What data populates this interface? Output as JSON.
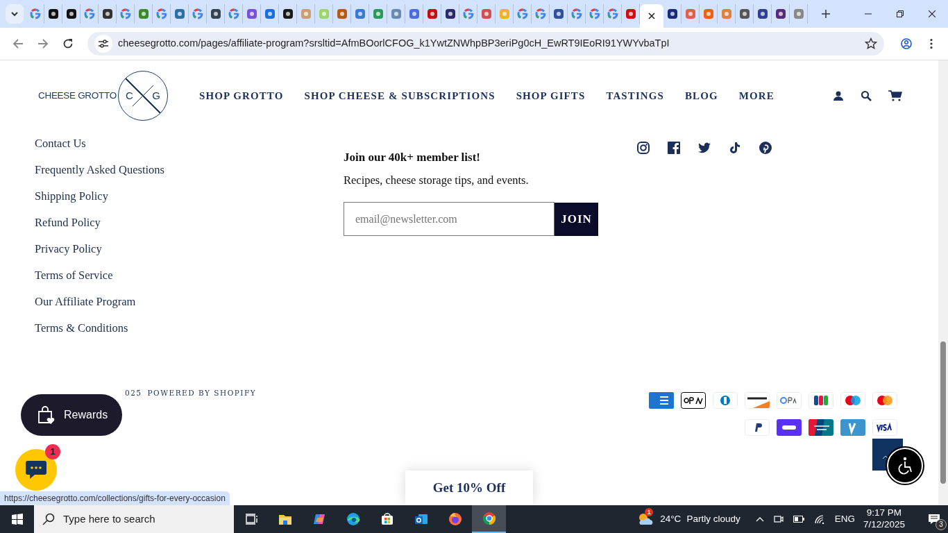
{
  "browser": {
    "tabs": [
      {
        "kind": "google",
        "selected": false
      },
      {
        "kind": "icon",
        "color": "#111111",
        "selected": false
      },
      {
        "kind": "icon",
        "color": "#111111",
        "selected": false
      },
      {
        "kind": "google",
        "selected": false
      },
      {
        "kind": "icon",
        "color": "#333333",
        "selected": false
      },
      {
        "kind": "google",
        "selected": false
      },
      {
        "kind": "icon",
        "color": "#3a8a2a",
        "selected": false
      },
      {
        "kind": "google",
        "selected": false
      },
      {
        "kind": "icon",
        "color": "#2a6fa8",
        "selected": false
      },
      {
        "kind": "google",
        "selected": false
      },
      {
        "kind": "icon",
        "color": "#334455",
        "selected": false
      },
      {
        "kind": "google",
        "selected": false
      },
      {
        "kind": "icon",
        "color": "#7b4fd6",
        "selected": false
      },
      {
        "kind": "icon",
        "color": "#1a6fe0",
        "selected": false
      },
      {
        "kind": "icon",
        "color": "#1a1a1a",
        "selected": false
      },
      {
        "kind": "icon",
        "color": "#c9a070",
        "selected": false
      },
      {
        "kind": "icon",
        "color": "#9bd66a",
        "selected": false
      },
      {
        "kind": "icon",
        "color": "#b55a10",
        "selected": false
      },
      {
        "kind": "icon",
        "color": "#3a78d8",
        "selected": false
      },
      {
        "kind": "icon",
        "color": "#2a9a5a",
        "selected": false
      },
      {
        "kind": "icon",
        "color": "#6a8ab0",
        "selected": false
      },
      {
        "kind": "icon",
        "color": "#4a6ae0",
        "selected": false
      },
      {
        "kind": "icon",
        "color": "#c01010",
        "selected": false
      },
      {
        "kind": "icon",
        "color": "#2a2a6a",
        "selected": false
      },
      {
        "kind": "google",
        "selected": false
      },
      {
        "kind": "icon",
        "color": "#d05050",
        "selected": false
      },
      {
        "kind": "icon",
        "color": "#f0b030",
        "selected": false
      },
      {
        "kind": "google",
        "selected": false
      },
      {
        "kind": "google",
        "selected": false
      },
      {
        "kind": "icon",
        "color": "#3050a0",
        "selected": false
      },
      {
        "kind": "google",
        "selected": false
      },
      {
        "kind": "google",
        "selected": false
      },
      {
        "kind": "google",
        "selected": false
      },
      {
        "kind": "icon",
        "color": "#d01010",
        "selected": false
      },
      {
        "selected": true
      },
      {
        "kind": "icon",
        "color": "#1a2a7a",
        "selected": false
      },
      {
        "kind": "icon",
        "color": "#e06050",
        "selected": false
      },
      {
        "kind": "icon",
        "color": "#f06010",
        "selected": false
      },
      {
        "kind": "icon",
        "color": "#e08040",
        "selected": false
      },
      {
        "kind": "icon",
        "color": "#555555",
        "selected": false
      },
      {
        "kind": "icon",
        "color": "#304090",
        "selected": false
      },
      {
        "kind": "icon",
        "color": "#5a2a7a",
        "selected": false
      },
      {
        "kind": "icon",
        "color": "#888888",
        "selected": false
      }
    ],
    "address": "cheesegrotto.com/pages/affiliate-program?srsltid=AfmBOorlCFOG_k1YwtZNWhpBP3eriPg0cH_EwRT9IEoRI91YWYvbaTpI",
    "status_url": "https://cheesegrotto.com/collections/gifts-for-every-occasion"
  },
  "site": {
    "logo": {
      "text": "CHEESE GROTTO",
      "letters": [
        "C",
        "G"
      ]
    },
    "nav": [
      "SHOP GROTTO",
      "SHOP CHEESE & SUBSCRIPTIONS",
      "SHOP GIFTS",
      "TASTINGS",
      "BLOG",
      "MORE"
    ],
    "footer_links": [
      "Contact Us",
      "Frequently Asked Questions",
      "Shipping Policy",
      "Refund Policy",
      "Privacy Policy",
      "Terms of Service",
      "Our Affiliate Program",
      "Terms & Conditions"
    ],
    "newsletter": {
      "heading": "Join our 40k+ member list!",
      "text": "Recipes, cheese storage tips, and events.",
      "placeholder": "email@newsletter.com",
      "button": "JOIN"
    },
    "social": [
      {
        "kind": "instagram"
      },
      {
        "kind": "facebook"
      },
      {
        "kind": "twitter"
      },
      {
        "kind": "tiktok"
      },
      {
        "kind": "pinterest"
      }
    ],
    "copyright": "025",
    "powered": "POWERED BY SHOPIFY",
    "payments": [
      {
        "kind": "amex"
      },
      {
        "kind": "applepay"
      },
      {
        "kind": "diners"
      },
      {
        "kind": "discover"
      },
      {
        "kind": "googlepay"
      },
      {
        "kind": "jcb"
      },
      {
        "kind": "maestro"
      },
      {
        "kind": "mastercard"
      },
      {
        "kind": "paypal"
      },
      {
        "kind": "shop"
      },
      {
        "kind": "unionpay"
      },
      {
        "kind": "venmo"
      },
      {
        "kind": "visa"
      }
    ],
    "rewards": "Rewards",
    "chat_badge": "1",
    "promo": "Get 10% Off"
  },
  "taskbar": {
    "search_placeholder": "Type here to search",
    "apps": [
      {
        "kind": "taskview",
        "selected": false
      },
      {
        "kind": "explorer",
        "selected": false
      },
      {
        "kind": "copilot",
        "selected": false
      },
      {
        "kind": "edge",
        "selected": false
      },
      {
        "kind": "store",
        "selected": false
      },
      {
        "kind": "outlook",
        "selected": false
      },
      {
        "kind": "firefox",
        "selected": false
      },
      {
        "kind": "chrome",
        "selected": true
      }
    ],
    "weather": {
      "badge": "1",
      "temp": "24°C",
      "text": "Partly cloudy"
    },
    "lang": "ENG",
    "time": "9:17 PM",
    "date": "7/12/2025",
    "notifications": "3"
  }
}
